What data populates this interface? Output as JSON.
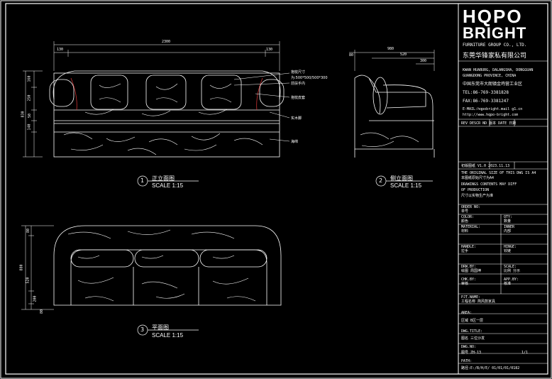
{
  "logo": {
    "line1": "HQPO",
    "line2": "BRIGHT",
    "sub": "FURNITURE GROUP CO., LTD.",
    "cn": "东莞华锋家私有限公司"
  },
  "address": [
    "KWAN HUABURG, DALANGSHA, DONGGUAN",
    "GUANGDONG PROVINCE, CHINA",
    "中国东莞市大朗镇金鸡营工业区",
    "TEL:86-769-3381828",
    "FAX:86-769-3381247",
    "E-MAIL:hqpobright.mail g1.cn",
    "http://www.hqpo-bright.com"
  ],
  "rev_header": "REV  DESCR   ND 版本  DATE 日期",
  "rev_row": "初版图纸    V1.0    2023.11.13",
  "notice": [
    "THE ORIGINAL SIZE OF THIS DWG IS A4",
    "本图纸原始尺寸为A4",
    "DRAWINGS CONTENTS MAY DIFF",
    "OF PRODUCTION",
    "尺寸以实物生产为准"
  ],
  "title_block": [
    {
      "en": "ORDER NO:",
      "cn": "单号",
      "value_en": "",
      "value_cn": ""
    },
    {
      "en": "COLOR:",
      "cn": "颜色",
      "value_en": "QTY:",
      "value_cn": "数量"
    },
    {
      "en": "MATERIAL:",
      "cn": "材料",
      "value_en": "INNER",
      "value_cn": "内部"
    },
    {
      "en": "HANDLE:",
      "cn": "拉手",
      "value_en": "HINGE:",
      "value_cn": "铰链"
    },
    {
      "en": "DRW.BY:",
      "cn": "绘图 周国坤",
      "value_en": "SCALE:",
      "value_cn": "比例 分示"
    },
    {
      "en": "CHK.BY:",
      "cn": "审核",
      "value_en": "APP.BY:",
      "value_cn": "核准"
    },
    {
      "en": "PJT.NAME:",
      "cn": "工程名称    简风款家具",
      "value_en": "",
      "value_cn": ""
    },
    {
      "en": "AREA:",
      "cn": "区域      B区一层",
      "value_en": "",
      "value_cn": ""
    },
    {
      "en": "DWG.TITLE:",
      "cn": "图名      三位沙发",
      "value_en": "",
      "value_cn": ""
    },
    {
      "en": "DWG.NO:",
      "cn": "图号      ZH-13",
      "value_en": "1/1",
      "value_cn": ""
    },
    {
      "en": "PATH:",
      "cn": "路径:E:/B/H/E/    01/01/01/0182",
      "value_en": "",
      "value_cn": ""
    }
  ],
  "views": {
    "front": {
      "num": "1",
      "title": "正立面图",
      "scale": "SCALE 1:15"
    },
    "side": {
      "num": "2",
      "title": "侧立面图",
      "scale": "SCALE 1:15"
    },
    "plan": {
      "num": "3",
      "title": "平面图",
      "scale": "SCALE 1:15"
    }
  },
  "dims": {
    "front_total": "2300",
    "front_left": "130",
    "front_right": "130",
    "front_h": "830",
    "front_h1": "160",
    "front_h2": "250",
    "front_h3": "50",
    "front_h4": "140",
    "side_total": "980",
    "side_mid": "520",
    "side_small": "80",
    "side_right": "300",
    "plan_d": "880",
    "plan_a": "80",
    "plan_b": "520",
    "plan_c": "200",
    "plan_e": "80"
  },
  "annotations": [
    "抱枕尺寸",
    "为:500*500/500*300",
    "前扶手内",
    "抱枕皮套",
    "实木脚",
    "海绵"
  ]
}
